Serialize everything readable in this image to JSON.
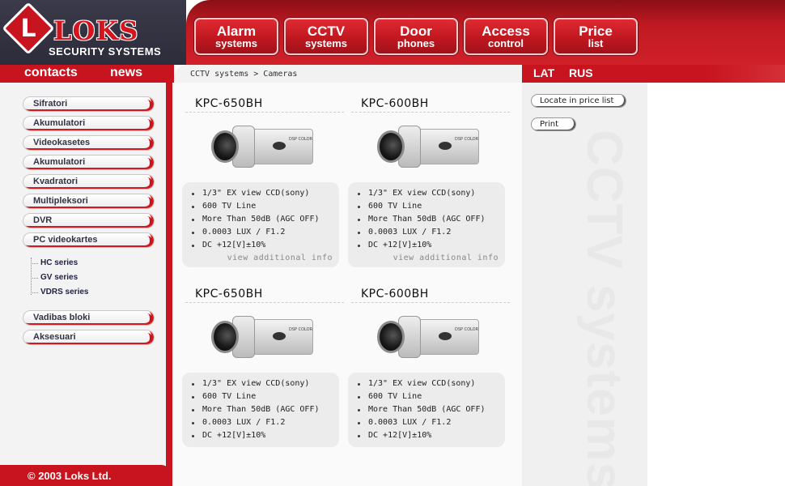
{
  "brand": {
    "name": "LOKS",
    "subtitle": "SECURITY SYSTEMS",
    "mark": "L",
    "colors": {
      "primary": "#c8141e",
      "dark": "#2c2c3a"
    }
  },
  "nav": [
    {
      "line1": "Alarm",
      "line2": "systems"
    },
    {
      "line1": "CCTV",
      "line2": "systems"
    },
    {
      "line1": "Door",
      "line2": "phones"
    },
    {
      "line1": "Access",
      "line2": "control"
    },
    {
      "line1": "Price",
      "line2": "list"
    }
  ],
  "top_links": {
    "contacts": "contacts",
    "news": "news"
  },
  "languages": {
    "lat": "LAT",
    "rus": "RUS"
  },
  "breadcrumb": "CCTV systems > Cameras",
  "sidebar": {
    "items": [
      {
        "label": "Sifratori"
      },
      {
        "label": "Akumulatori"
      },
      {
        "label": "Videokasetes"
      },
      {
        "label": "Akumulatori"
      },
      {
        "label": "Kvadratori"
      },
      {
        "label": "Multipleksori"
      },
      {
        "label": "DVR"
      },
      {
        "label": "PC videokartes"
      }
    ],
    "sub_items": [
      {
        "label": "HC series"
      },
      {
        "label": "GV series"
      },
      {
        "label": "VDRS series"
      }
    ],
    "items_after": [
      {
        "label": "Vadibas bloki"
      },
      {
        "label": "Aksesuari"
      }
    ]
  },
  "products": [
    {
      "title": "KPC-650BH",
      "camera_label": "DSP COLOR",
      "specs": [
        "1/3\" EX view CCD(sony)",
        "600 TV Line",
        "More Than 50dB (AGC OFF)",
        "0.0003 LUX / F1.2",
        "DC +12[V]±10%"
      ],
      "more": "view additional info"
    },
    {
      "title": "KPC-600BH",
      "camera_label": "DSP COLOR",
      "specs": [
        "1/3\" EX view CCD(sony)",
        "600 TV Line",
        "More Than 50dB (AGC OFF)",
        "0.0003 LUX / F1.2",
        "DC +12[V]±10%"
      ],
      "more": "view additional info"
    },
    {
      "title": "KPC-650BH",
      "camera_label": "DSP COLOR",
      "specs": [
        "1/3\" EX view CCD(sony)",
        "600 TV Line",
        "More Than 50dB (AGC OFF)",
        "0.0003 LUX / F1.2",
        "DC +12[V]±10%"
      ]
    },
    {
      "title": "KPC-600BH",
      "camera_label": "DSP COLOR",
      "specs": [
        "1/3\" EX view CCD(sony)",
        "600 TV Line",
        "More Than 50dB (AGC OFF)",
        "0.0003 LUX / F1.2",
        "DC +12[V]±10%"
      ]
    }
  ],
  "actions": {
    "locate": "Locate in price list",
    "print": "Print"
  },
  "watermark": "CCTV systems",
  "footer": "© 2003 Loks Ltd."
}
